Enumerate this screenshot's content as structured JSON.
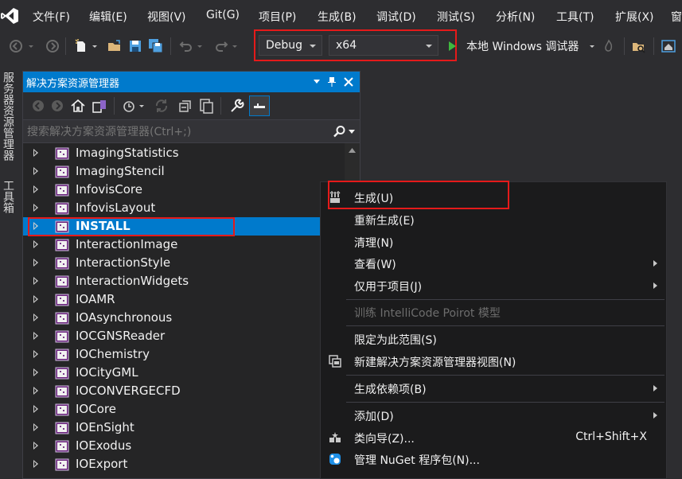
{
  "menubar": {
    "items": [
      "文件(F)",
      "编辑(E)",
      "视图(V)",
      "Git(G)",
      "项目(P)",
      "生成(B)",
      "调试(D)",
      "测试(S)",
      "分析(N)",
      "工具(T)",
      "扩展(X)",
      "窗"
    ]
  },
  "toolbar": {
    "configuration": "Debug",
    "platform": "x64",
    "debugger_label": "本地 Windows 调试器"
  },
  "side_tabs": [
    "服务器资源管理器",
    "工具箱"
  ],
  "solution_explorer": {
    "title": "解决方案资源管理器",
    "search_placeholder": "搜索解决方案资源管理器(Ctrl+;)",
    "projects": [
      "ImagingStatistics",
      "ImagingStencil",
      "InfovisCore",
      "InfovisLayout",
      "INSTALL",
      "InteractionImage",
      "InteractionStyle",
      "InteractionWidgets",
      "IOAMR",
      "IOAsynchronous",
      "IOCGNSReader",
      "IOChemistry",
      "IOCityGML",
      "IOCONVERGECFD",
      "IOCore",
      "IOEnSight",
      "IOExodus",
      "IOExport"
    ],
    "selected_project": "INSTALL"
  },
  "context_menu": {
    "build": "生成(U)",
    "rebuild": "重新生成(E)",
    "clean": "清理(N)",
    "view": "查看(W)",
    "project_only": "仅用于项目(J)",
    "train_intellicode": "训练 IntelliCode Poirot 模型",
    "scope_to_this": "限定为此范围(S)",
    "new_se_view": "新建解决方案资源管理器视图(N)",
    "build_dependencies": "生成依赖项(B)",
    "add": "添加(D)",
    "class_wizard": "类向导(Z)...",
    "class_wizard_shortcut": "Ctrl+Shift+X",
    "manage_nuget": "管理 NuGet 程序包(N)..."
  },
  "colors": {
    "accent": "#007acc",
    "highlight_box": "#e51a1a",
    "background": "#2d2d30"
  }
}
